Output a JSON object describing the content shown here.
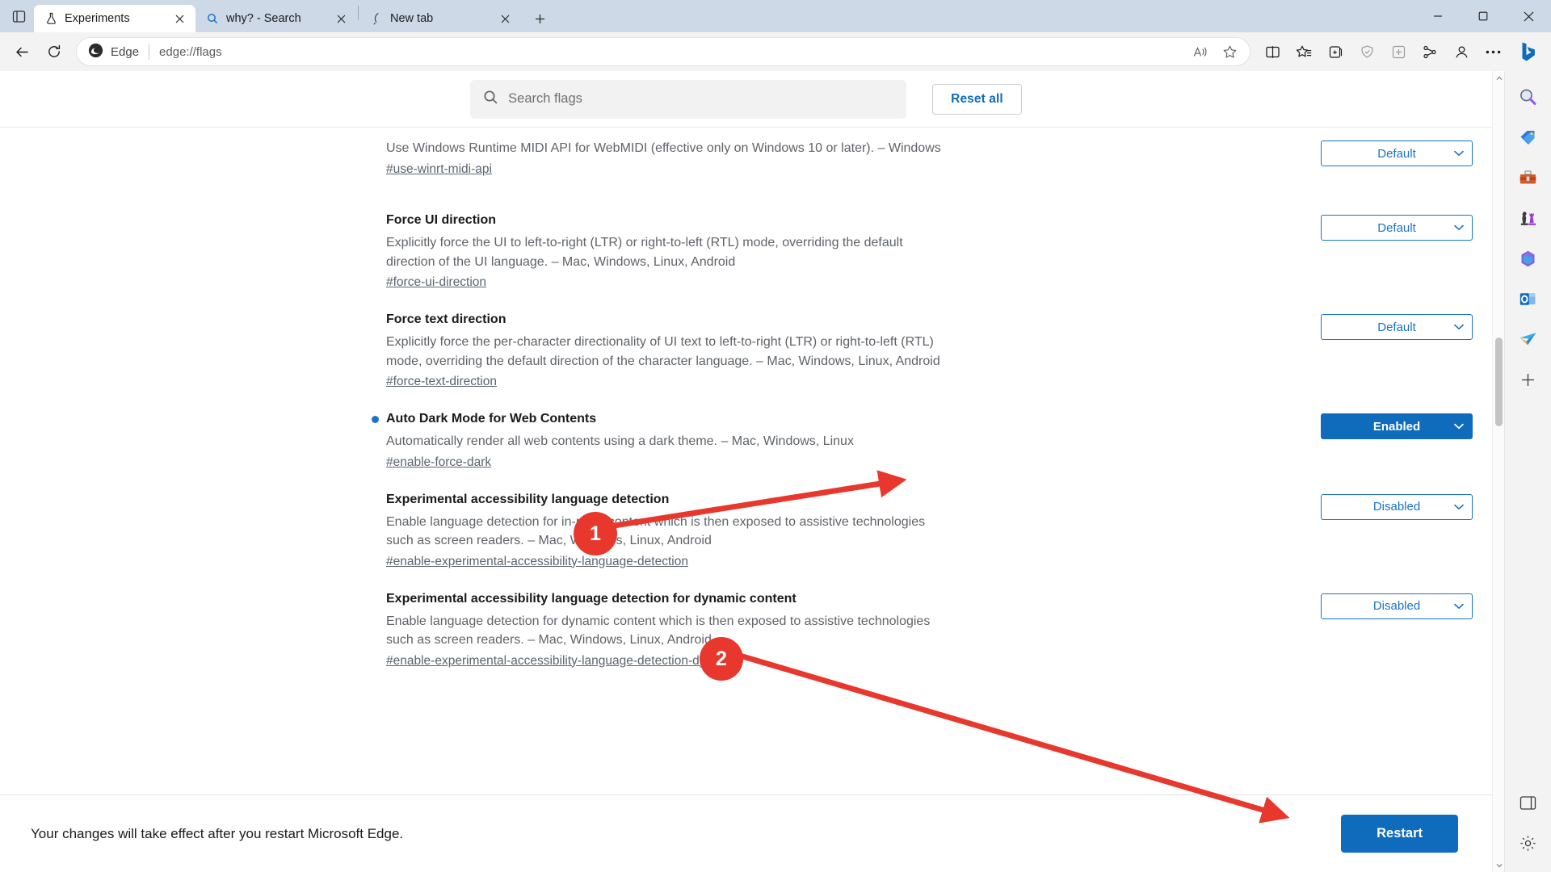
{
  "window": {
    "controls": [
      "minimize",
      "maximize",
      "close"
    ]
  },
  "tabs": {
    "tab_list_icon": "tab-list-icon",
    "new_tab_label": "+",
    "items": [
      {
        "title": "Experiments",
        "favicon": "flask-icon",
        "active": true,
        "closable": true
      },
      {
        "title": "why? - Search",
        "favicon": "search-icon",
        "active": false,
        "closable": true
      },
      {
        "title": "New tab",
        "favicon": "edge-feather-icon",
        "active": false,
        "closable": true
      }
    ]
  },
  "toolbar": {
    "back_icon": "back-arrow-icon",
    "refresh_icon": "refresh-icon",
    "brand_label": "Edge",
    "brand_icon": "edge-logo-icon",
    "url": "edge://flags",
    "omnibox_actions": [
      {
        "name": "read-aloud-icon",
        "label": "A"
      },
      {
        "name": "favorite-star-icon",
        "label": ""
      }
    ],
    "right_actions": [
      {
        "name": "split-screen-icon"
      },
      {
        "name": "favorites-icon"
      },
      {
        "name": "collections-icon"
      },
      {
        "name": "browser-essentials-icon"
      },
      {
        "name": "extensions-icon"
      },
      {
        "name": "copilot-apps-icon"
      },
      {
        "name": "profile-icon"
      },
      {
        "name": "settings-more-icon"
      }
    ],
    "bing_icon": "bing-copilot-icon"
  },
  "flags_page": {
    "search": {
      "placeholder": "Search flags",
      "value": "",
      "icon": "search-icon"
    },
    "reset_all_label": "Reset all",
    "items": [
      {
        "title": "",
        "has_title": false,
        "highlighted": false,
        "description": "Use Windows Runtime MIDI API for WebMIDI (effective only on Windows 10 or later). – Windows",
        "link": "#use-winrt-midi-api",
        "select": {
          "value": "Default",
          "state": "default"
        }
      },
      {
        "title": "Force UI direction",
        "has_title": true,
        "highlighted": false,
        "description": "Explicitly force the UI to left-to-right (LTR) or right-to-left (RTL) mode, overriding the default direction of the UI language. – Mac, Windows, Linux, Android",
        "link": "#force-ui-direction",
        "select": {
          "value": "Default",
          "state": "default"
        }
      },
      {
        "title": "Force text direction",
        "has_title": true,
        "highlighted": false,
        "description": "Explicitly force the per-character directionality of UI text to left-to-right (LTR) or right-to-left (RTL) mode, overriding the default direction of the character language. – Mac, Windows, Linux, Android",
        "link": "#force-text-direction",
        "select": {
          "value": "Default",
          "state": "default"
        }
      },
      {
        "title": "Auto Dark Mode for Web Contents",
        "has_title": true,
        "highlighted": true,
        "description": "Automatically render all web contents using a dark theme. – Mac, Windows, Linux",
        "link": "#enable-force-dark",
        "select": {
          "value": "Enabled",
          "state": "enabled"
        }
      },
      {
        "title": "Experimental accessibility language detection",
        "has_title": true,
        "highlighted": false,
        "description": "Enable language detection for in-page content which is then exposed to assistive technologies such as screen readers. – Mac, Windows, Linux, Android",
        "link": "#enable-experimental-accessibility-language-detection",
        "select": {
          "value": "Disabled",
          "state": "default"
        }
      },
      {
        "title": "Experimental accessibility language detection for dynamic content",
        "has_title": true,
        "highlighted": false,
        "description": "Enable language detection for dynamic content which is then exposed to assistive technologies such as screen readers. – Mac, Windows, Linux, Android",
        "link": "#enable-experimental-accessibility-language-detection-dynamic",
        "select": {
          "value": "Disabled",
          "state": "default"
        }
      }
    ],
    "relaunch": {
      "message": "Your changes will take effect after you restart Microsoft Edge.",
      "button_label": "Restart"
    }
  },
  "sidebar_rail": {
    "icons": [
      {
        "name": "search-magnifier-icon",
        "glyph": "🔍"
      },
      {
        "name": "shopping-tag-icon",
        "glyph": "🏷"
      },
      {
        "name": "tools-toolbox-icon",
        "glyph": "🧰"
      },
      {
        "name": "games-chess-icon",
        "glyph": "♟"
      },
      {
        "name": "microsoft-365-icon",
        "glyph": "🔷"
      },
      {
        "name": "outlook-icon",
        "glyph": "📧"
      },
      {
        "name": "paper-plane-icon",
        "glyph": "✈"
      },
      {
        "name": "add-sidebar-app-icon",
        "glyph": "+"
      }
    ],
    "bottom_icons": [
      {
        "name": "sidebar-toggle-icon",
        "glyph": "▢"
      },
      {
        "name": "sidebar-settings-icon",
        "glyph": "⚙"
      }
    ]
  },
  "annotations": {
    "accent_color": "#e8372c",
    "markers": [
      {
        "label": "1",
        "target": "auto-dark-mode-select"
      },
      {
        "label": "2",
        "target": "restart-button"
      }
    ]
  },
  "colors": {
    "accent_blue": "#0f6cbd",
    "link_blue": "#1a73c9",
    "titlebar": "#cdd9e6",
    "toolbar": "#f3f3f3",
    "annotation_red": "#e8372c"
  }
}
